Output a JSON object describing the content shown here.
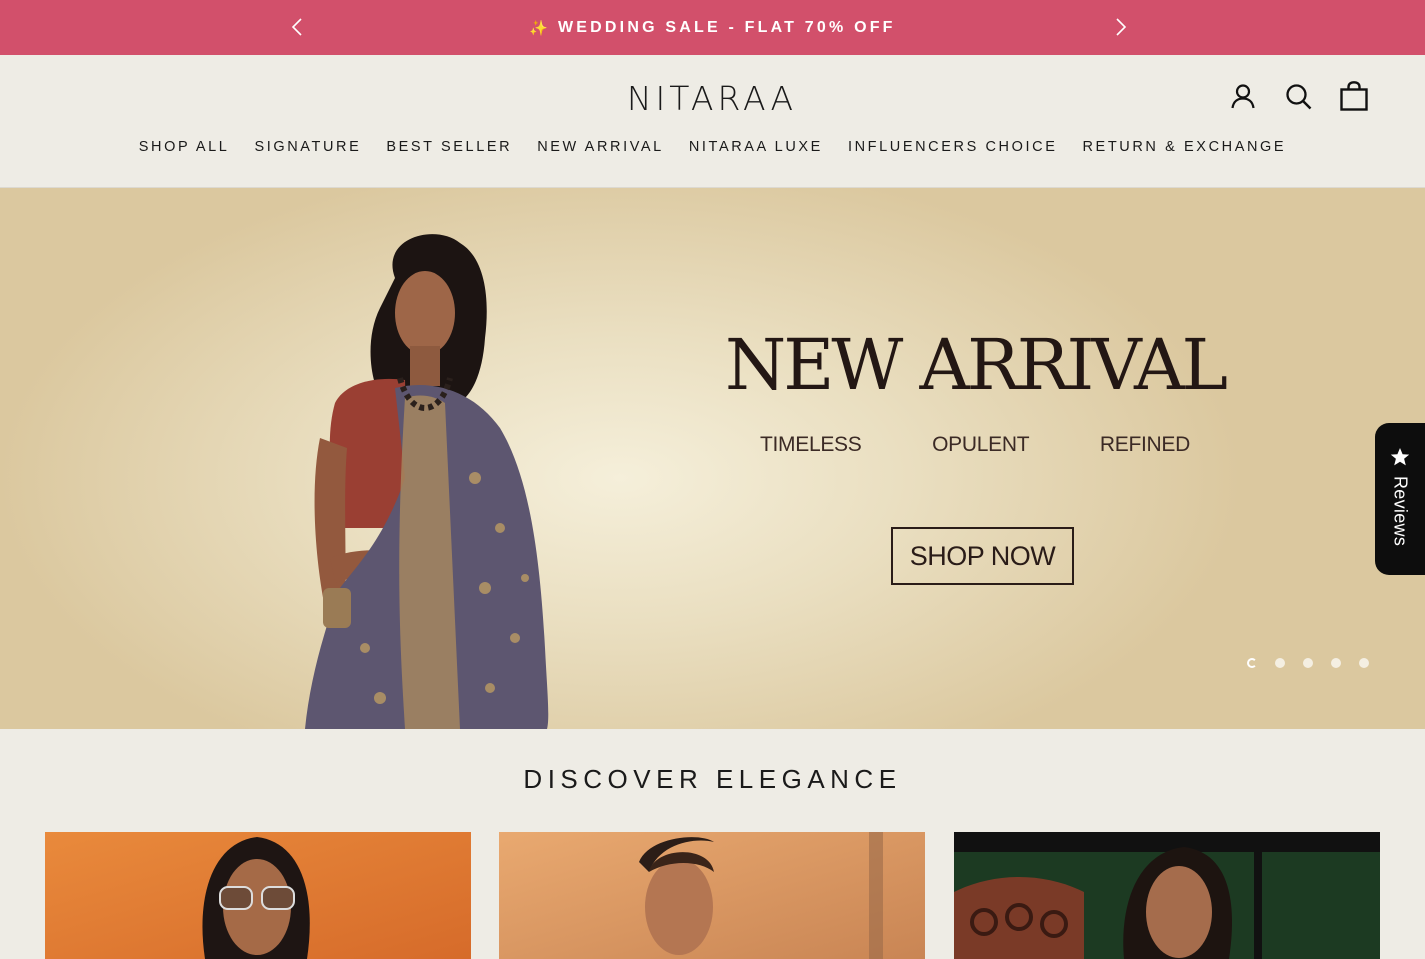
{
  "announcement": {
    "sparkle": "✨",
    "text": "WEDDING SALE - FLAT 70% OFF"
  },
  "header": {
    "logo": "NITARAA",
    "nav": [
      {
        "label": "SHOP ALL"
      },
      {
        "label": "SIGNATURE"
      },
      {
        "label": "BEST SELLER"
      },
      {
        "label": "NEW ARRIVAL"
      },
      {
        "label": "NITARAA LUXE"
      },
      {
        "label": "INFLUENCERS CHOICE"
      },
      {
        "label": "RETURN & EXCHANGE"
      }
    ]
  },
  "hero": {
    "title": "NEW ARRIVAL",
    "words": [
      "TIMELESS",
      "OPULENT",
      "REFINED"
    ],
    "cta": "SHOP NOW",
    "slide_count": 5,
    "active_slide": 1
  },
  "reviews_tab": {
    "label": "Reviews"
  },
  "discover": {
    "title": "DISCOVER ELEGANCE"
  },
  "colors": {
    "announcement_bg": "#D2506B",
    "page_bg": "#EEECE5",
    "hero_text": "#231714"
  }
}
